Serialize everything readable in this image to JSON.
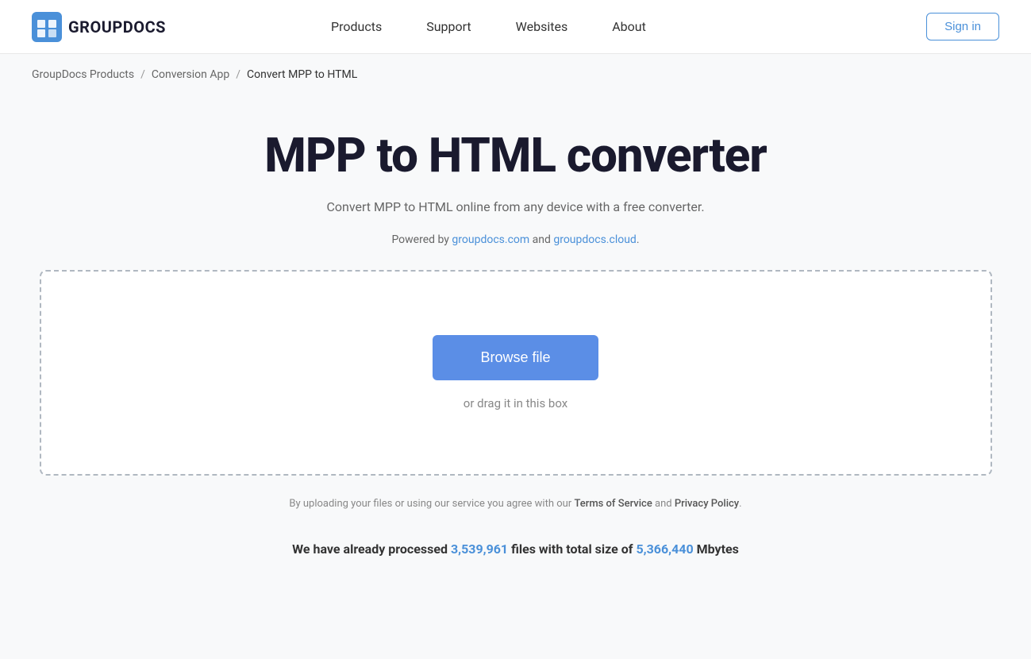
{
  "header": {
    "logo_text": "GROUPDOCS",
    "nav_items": [
      {
        "label": "Products",
        "href": "#"
      },
      {
        "label": "Support",
        "href": "#"
      },
      {
        "label": "Websites",
        "href": "#"
      },
      {
        "label": "About",
        "href": "#"
      }
    ],
    "signin_label": "Sign in"
  },
  "breadcrumb": {
    "items": [
      {
        "label": "GroupDocs Products",
        "href": "#"
      },
      {
        "label": "Conversion App",
        "href": "#"
      },
      {
        "label": "Convert MPP to HTML",
        "href": null
      }
    ]
  },
  "main": {
    "page_title": "MPP to HTML converter",
    "subtitle": "Convert MPP to HTML online from any device with a free converter.",
    "powered_by_prefix": "Powered by ",
    "powered_by_link1_label": "groupdocs.com",
    "powered_by_link1_href": "#",
    "powered_by_and": " and ",
    "powered_by_link2_label": "groupdocs.cloud",
    "powered_by_link2_href": "#",
    "powered_by_suffix": ".",
    "browse_btn_label": "Browse file",
    "drag_text": "or drag it in this box",
    "terms_prefix": "By uploading your files or using our service you agree with our ",
    "terms_link1_label": "Terms of Service",
    "terms_link1_href": "#",
    "terms_and": " and ",
    "terms_link2_label": "Privacy Policy",
    "terms_link2_href": "#",
    "terms_suffix": ".",
    "stats_prefix": "We have already processed ",
    "stats_files_count": "3,539,961",
    "stats_middle": " files with total size of ",
    "stats_size": "5,366,440",
    "stats_suffix": " Mbytes"
  }
}
